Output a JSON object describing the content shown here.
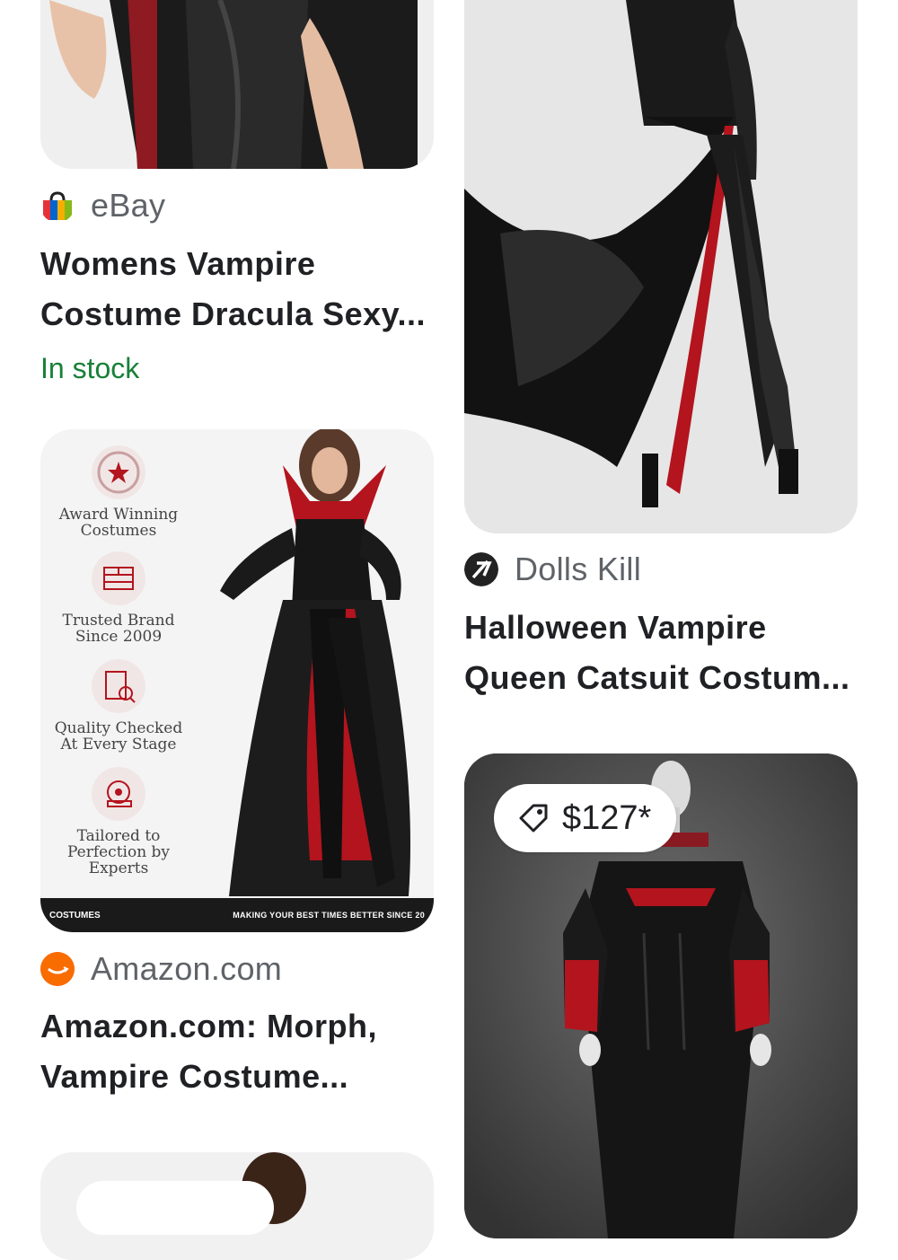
{
  "cards": [
    {
      "source": "eBay",
      "source_icon": "ebay-bag-icon",
      "title_lines": [
        "Womens Vampire",
        "Costume Dracula Sexy..."
      ],
      "stock": "In stock"
    },
    {
      "source": "Dolls Kill",
      "source_icon": "dolls-kill-logo-icon",
      "title_lines": [
        "Halloween Vampire",
        "Queen Catsuit Costum..."
      ]
    },
    {
      "source": "Amazon.com",
      "source_icon": "amazon-logo-icon",
      "title_lines": [
        "Amazon.com: Morph,",
        "Vampire Costume..."
      ],
      "image_features": [
        {
          "line1": "Award Winning",
          "line2": "Costumes"
        },
        {
          "line1": "Trusted Brand",
          "line2": "Since 2009"
        },
        {
          "line1": "Quality Checked",
          "line2": "At Every Stage"
        },
        {
          "line1": "Tailored to",
          "line2": "Perfection by",
          "line3": "Experts"
        }
      ],
      "image_banner": "MAKING YOUR BEST TIMES BETTER SINCE 20",
      "image_brand": "COSTUMES"
    },
    {
      "price": "$127*",
      "price_icon": "tag-icon"
    }
  ],
  "colors": {
    "stock_green": "#188038",
    "amazon_orange": "#ff9900",
    "costume_red": "#b3141e"
  }
}
